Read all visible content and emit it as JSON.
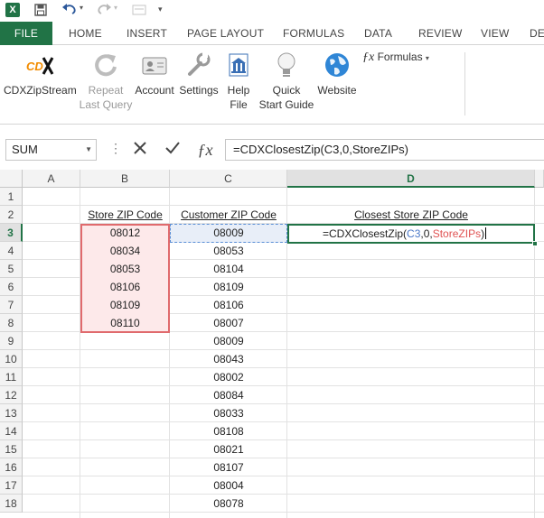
{
  "quick_access": {
    "excel_icon_label": "X",
    "save_icon": "save-icon",
    "undo_icon": "undo-icon",
    "redo_icon": "redo-icon",
    "customize_icon": "customize-qat-icon"
  },
  "tabs": [
    "FILE",
    "HOME",
    "INSERT",
    "PAGE LAYOUT",
    "FORMULAS",
    "DATA",
    "REVIEW",
    "VIEW",
    "DE"
  ],
  "ribbon": {
    "buttons": [
      {
        "label": "CDXZipStream",
        "icon": "cdx-logo-icon"
      },
      {
        "label": "Repeat",
        "label2": "Last Query",
        "icon": "repeat-icon"
      },
      {
        "label": "Account",
        "icon": "account-icon"
      },
      {
        "label": "Settings",
        "icon": "settings-icon"
      },
      {
        "label": "Help",
        "label2": "File",
        "icon": "help-file-icon"
      },
      {
        "label": "Quick",
        "label2": "Start Guide",
        "icon": "lightbulb-icon"
      },
      {
        "label": "Website",
        "icon": "globe-icon"
      }
    ],
    "formulas_dropdown": "Formulas"
  },
  "formula_bar": {
    "name_box": "SUM",
    "formula": "=CDXClosestZip(C3,0,StoreZIPs)"
  },
  "sheet": {
    "columns": [
      "A",
      "B",
      "C",
      "D"
    ],
    "rows": [
      "1",
      "2",
      "3",
      "4",
      "5",
      "6",
      "7",
      "8",
      "9",
      "10",
      "11",
      "12",
      "13",
      "14",
      "15",
      "16",
      "17",
      "18"
    ],
    "headers": {
      "store": "Store ZIP Code",
      "customer": "Customer ZIP Code",
      "closest": "Closest Store ZIP Code"
    },
    "store_zips": [
      "08012",
      "08034",
      "08053",
      "08106",
      "08109",
      "08110"
    ],
    "customer_zips": [
      "08009",
      "08053",
      "08104",
      "08109",
      "08106",
      "08007",
      "08009",
      "08043",
      "08002",
      "08084",
      "08033",
      "08108",
      "08021",
      "08107",
      "08004",
      "08078"
    ],
    "editing": {
      "prefix": "=CDXClosestZip(",
      "ref1": "C3",
      "mid": ",0,",
      "ref2": "StoreZIPs",
      "suffix": ")"
    }
  },
  "colors": {
    "accent": "#217346",
    "store_range": "#e06a6d",
    "customer_ref": "#5b8fd6"
  }
}
